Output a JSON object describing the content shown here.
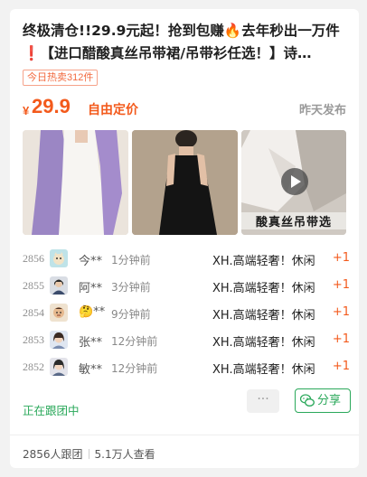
{
  "post": {
    "title_part1": "终极清仓!!29.9元起！抢到包赚",
    "title_part2": "去年秒出一万件",
    "title_part3": "【进口醋酸真丝吊带裙/吊带衫任选！】诗…",
    "fire_icon": "🔥",
    "excl_icon": "❗",
    "hot_tag": "今日热卖312件",
    "price_symbol": "¥",
    "price": "29.9",
    "price_note": "自由定价",
    "publish_time": "昨天发布",
    "photo3_caption": "酸真丝吊带选"
  },
  "followers": [
    {
      "num": "2856",
      "name": "今**",
      "time": "1分钟前",
      "product": "XH.高端轻奢！休闲",
      "plus": "+1",
      "avatar": "avatar-cat-icon"
    },
    {
      "num": "2855",
      "name": "阿**",
      "time": "3分钟前",
      "product": "XH.高端轻奢！休闲",
      "plus": "+1",
      "avatar": "avatar-person-icon"
    },
    {
      "num": "2854",
      "name": "🤔**",
      "time": "9分钟前",
      "product": "XH.高端轻奢！休闲",
      "plus": "+1",
      "avatar": "avatar-character-icon"
    },
    {
      "num": "2853",
      "name": "张**",
      "time": "12分钟前",
      "product": "XH.高端轻奢！休闲",
      "plus": "+1",
      "avatar": "avatar-girl-icon"
    },
    {
      "num": "2852",
      "name": "敏**",
      "time": "12分钟前",
      "product": "XH.高端轻奢！休闲",
      "plus": "+1",
      "avatar": "avatar-girl-icon"
    }
  ],
  "actions": {
    "following_label": "正在跟团中",
    "more_label": "···",
    "share_label": "分享"
  },
  "stats": {
    "group_count": "2856人跟团",
    "views": "5.1万人查看"
  },
  "colors": {
    "accent_orange": "#f35a1c",
    "accent_green": "#2aa85a"
  }
}
